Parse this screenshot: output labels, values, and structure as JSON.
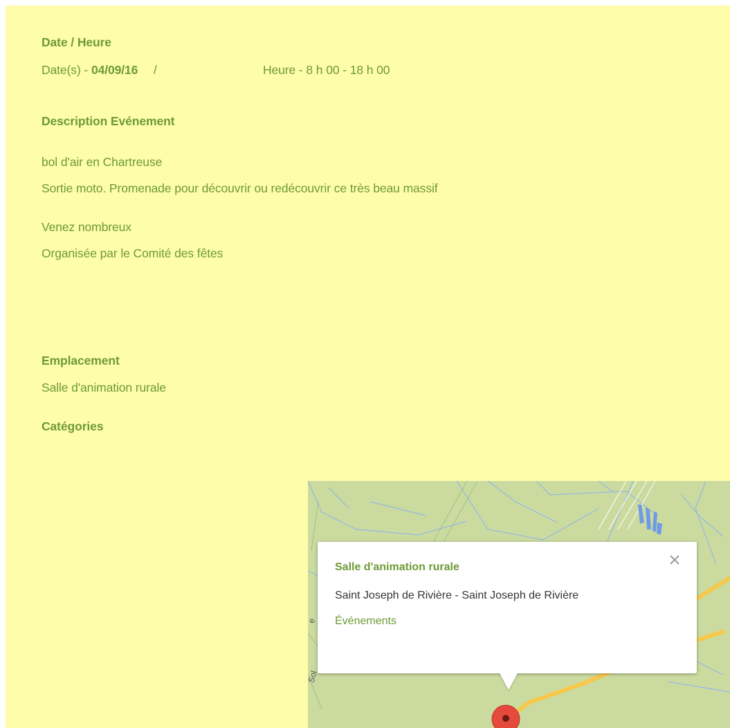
{
  "datetime": {
    "heading": "Date / Heure",
    "date_prefix": "Date(s) - ",
    "date_value": "04/09/16",
    "separator": "/",
    "time_text": "Heure - 8 h 00 - 18 h 00"
  },
  "description": {
    "heading": "Description Evénement",
    "lines": [
      "bol d'air en Chartreuse",
      "Sortie moto. Promenade pour découvrir ou redécouvrir ce très beau massif",
      "Venez nombreux",
      "Organisée par le Comité des fêtes"
    ]
  },
  "location": {
    "heading": "Emplacement",
    "value": "Salle d'animation rurale"
  },
  "categories": {
    "heading": "Catégories"
  },
  "map": {
    "infowindow": {
      "title": "Salle d'animation rurale",
      "address": "Saint Joseph de Rivière - Saint Joseph de Rivière",
      "link": "Événements"
    },
    "road_labels": [
      "e",
      "Sol"
    ]
  },
  "colors": {
    "panel_background": "#fefdaa",
    "text": "#6e9a37",
    "map_land": "#cbdb9f",
    "map_road": "#f7c84a",
    "marker": "#e64a3c"
  }
}
